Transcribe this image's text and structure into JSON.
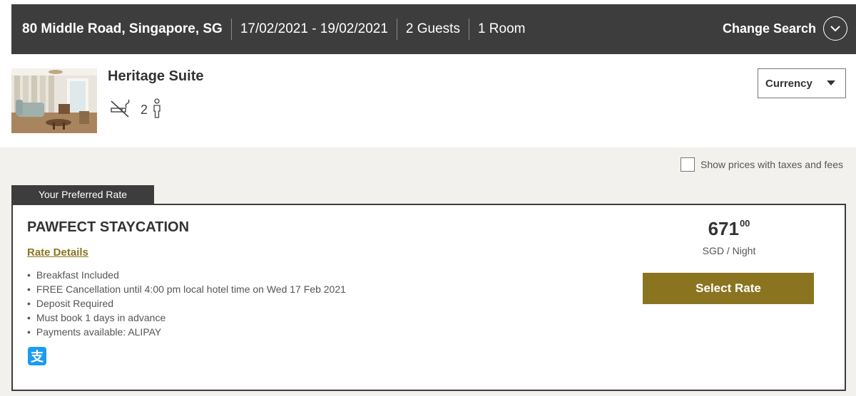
{
  "search": {
    "location": "80 Middle Road, Singapore, SG",
    "dates": "17/02/2021 - 19/02/2021",
    "guests": "2 Guests",
    "rooms": "1 Room",
    "change_label": "Change Search"
  },
  "room": {
    "title": "Heritage Suite",
    "max_occupancy": "2",
    "amenities_icons": [
      "no-smoking-icon",
      "person-icon"
    ]
  },
  "currency": {
    "label": "Currency"
  },
  "taxes_toggle": {
    "label": "Show prices with taxes and fees",
    "checked": false
  },
  "rate": {
    "tab_label": "Your Preferred Rate",
    "name": "PAWFECT STAYCATION",
    "details_link": "Rate Details",
    "features": [
      "Breakfast Included",
      "FREE Cancellation until 4:00 pm local hotel time on Wed 17 Feb 2021",
      "Deposit Required",
      "Must book 1 days in advance",
      "Payments available: ALIPAY"
    ],
    "payment_icon": "alipay-icon",
    "price_whole": "671",
    "price_cents": "00",
    "price_unit": "SGD / Night",
    "select_label": "Select Rate"
  },
  "colors": {
    "header_bg": "#3e3d3d",
    "accent_gold": "#8b7420",
    "page_bg": "#f2f1ed",
    "alipay_blue": "#1a9cf0"
  }
}
